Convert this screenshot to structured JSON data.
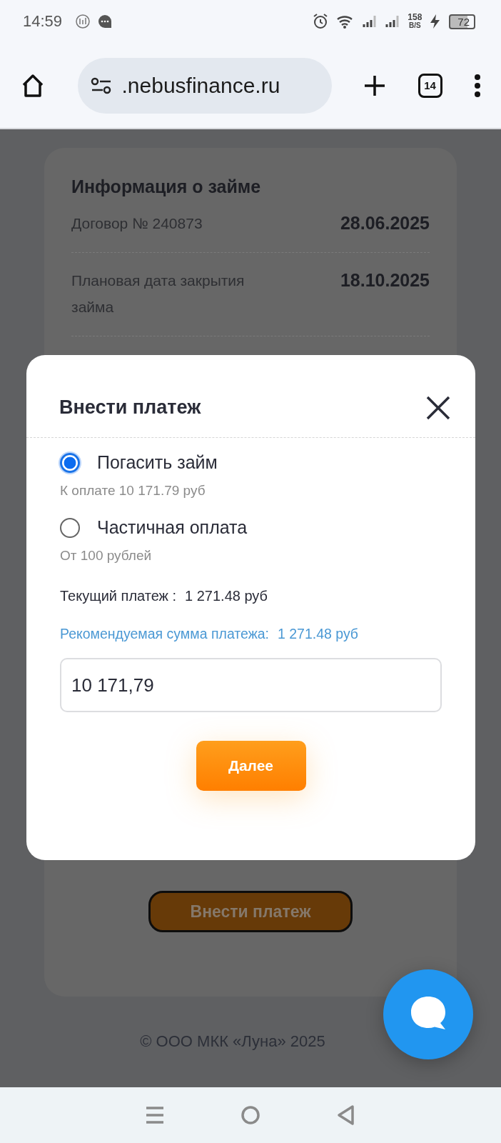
{
  "status_bar": {
    "time": "14:59",
    "net_speed": "158",
    "net_speed_unit": "B/S",
    "battery": "72"
  },
  "browser": {
    "url": ".nebusfinance.ru",
    "tab_count": "14"
  },
  "loan_info": {
    "title": "Информация о займе",
    "rows": [
      {
        "label": "Договор № 240873",
        "value": "28.06.2025"
      },
      {
        "label": "Плановая дата закрытия займа",
        "value": "18.10.2025"
      }
    ]
  },
  "pay_button": "Внести платеж",
  "footer": "© ООО МКК «Луна» 2025",
  "dialog": {
    "title": "Внести платеж",
    "options": [
      {
        "label": "Погасить займ",
        "hint": "К оплате 10 171.79 руб",
        "selected": true
      },
      {
        "label": "Частичная оплата",
        "hint": "От 100 рублей",
        "selected": false
      }
    ],
    "current_payment": {
      "label": "Текущий платеж :",
      "value": "1 271.48 руб"
    },
    "recommended": {
      "label": "Рекомендуемая сумма платежа:",
      "value": "1 271.48 руб"
    },
    "amount": {
      "value": "10 171,79"
    },
    "next_button": "Далее"
  }
}
